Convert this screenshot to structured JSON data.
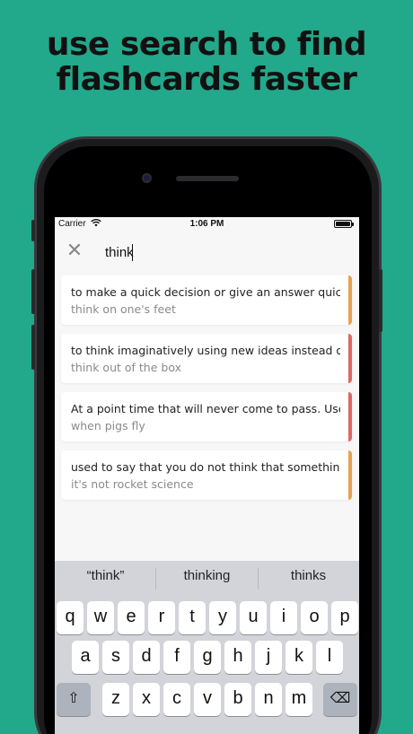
{
  "promo": {
    "line1": "use search to find",
    "line2": "flashcards faster"
  },
  "status_bar": {
    "carrier": "Carrier",
    "wifi_icon": "wifi-icon",
    "time": "1:06 PM",
    "battery_icon": "battery-icon"
  },
  "search": {
    "close_icon": "close-icon",
    "close_glyph": "✕",
    "value": "think"
  },
  "results": [
    {
      "definition": "to make a quick decision or give an answer quickly",
      "term": "think on one's feet",
      "color": "#e8a14f"
    },
    {
      "definition": "to think imaginatively using new ideas instead of traditional",
      "term": "think out of the box",
      "color": "#e06666"
    },
    {
      "definition": "At a point time that will never come to pass. Used",
      "term": "when pigs fly",
      "color": "#e06666"
    },
    {
      "definition": "used to say that you do not think that something is",
      "term": "it's not rocket science",
      "color": "#e8a14f"
    }
  ],
  "keyboard": {
    "suggestions": [
      "“think”",
      "thinking",
      "thinks"
    ],
    "row1": [
      "q",
      "w",
      "e",
      "r",
      "t",
      "y",
      "u",
      "i",
      "o",
      "p"
    ],
    "row2": [
      "a",
      "s",
      "d",
      "f",
      "g",
      "h",
      "j",
      "k",
      "l"
    ],
    "row3": [
      "z",
      "x",
      "c",
      "v",
      "b",
      "n",
      "m"
    ],
    "shift_icon": "shift-icon",
    "shift_glyph": "⇧",
    "delete_icon": "delete-icon",
    "delete_glyph": "⌫"
  }
}
